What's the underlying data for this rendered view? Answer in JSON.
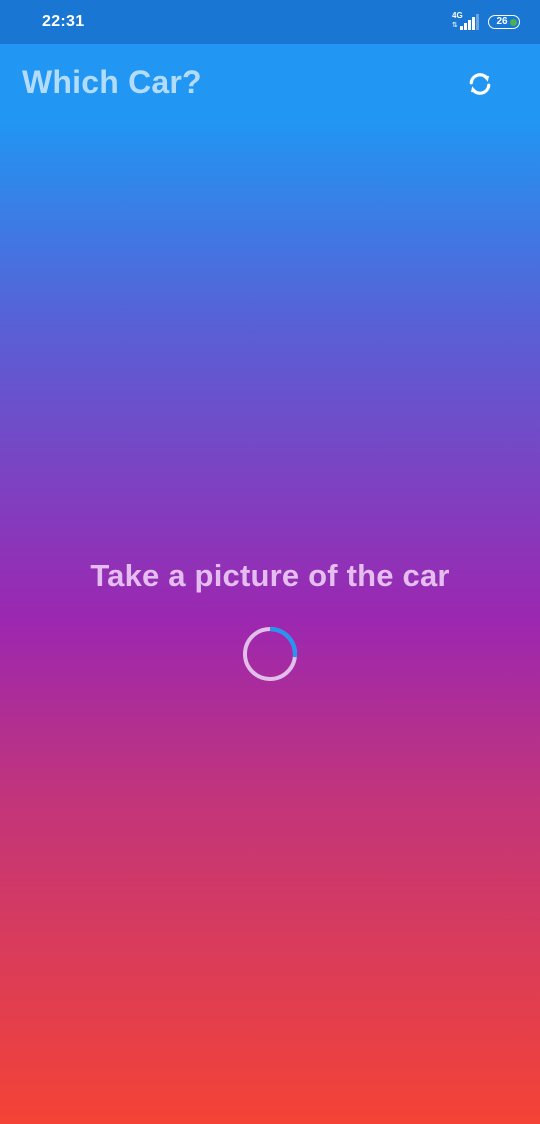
{
  "status_bar": {
    "time": "22:31",
    "network_type": "4G",
    "network_arrows": "⇅",
    "battery_level": "26",
    "signal_strength": 4
  },
  "app_bar": {
    "title": "Which Car?",
    "refresh_icon": "refresh-icon"
  },
  "main": {
    "prompt": "Take a picture of the car",
    "spinner_progress": 0.27
  },
  "colors": {
    "status_bar": "#1976D2",
    "gradient_top": "#2196F3",
    "gradient_middle": "#9c27b0",
    "gradient_bottom": "#f44336",
    "title_text": "#b3dcfb",
    "prompt_text": "#e5bdf0",
    "spinner_track": "#e1bfea",
    "spinner_arc": "#2196F3",
    "battery_dot": "#4CAF50"
  }
}
